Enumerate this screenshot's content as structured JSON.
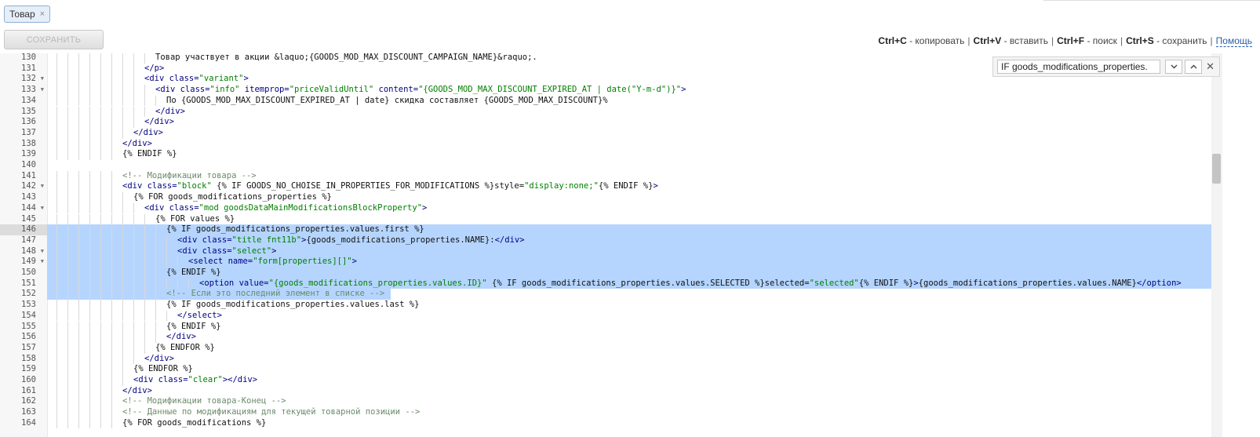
{
  "tab": {
    "label": "Товар",
    "close": "×"
  },
  "toolbar": {
    "save_label": "СОХРАНИТЬ"
  },
  "hints": {
    "copy_key": "Ctrl+C",
    "copy_text": " - копировать",
    "paste_key": "Ctrl+V",
    "paste_text": " - вставить",
    "find_key": "Ctrl+F",
    "find_text": " - поиск",
    "save_key": "Ctrl+S",
    "save_text": " - сохранить",
    "sep": "|",
    "help": "Помощь"
  },
  "search": {
    "value": "IF goods_modifications_properties."
  },
  "icons": {
    "down": "chevron-down-icon",
    "up": "chevron-up-icon",
    "close": "close-icon"
  },
  "colors": {
    "selection": "#b5d5ff",
    "tag": "#000080",
    "string": "#008000",
    "comment": "#6a8a6a"
  },
  "editor": {
    "active_line": 146,
    "lines": [
      {
        "n": "130",
        "fold": false,
        "indent": 9,
        "sel": false,
        "segs": [
          [
            "t",
            "Товар участвует в акции &laquo;{GOODS_MOD_MAX_DISCOUNT_CAMPAIGN_NAME}&raquo;."
          ]
        ]
      },
      {
        "n": "131",
        "fold": false,
        "indent": 8,
        "sel": false,
        "segs": [
          [
            "g",
            "</p>"
          ]
        ]
      },
      {
        "n": "132",
        "fold": true,
        "indent": 8,
        "sel": false,
        "segs": [
          [
            "g",
            "<div class="
          ],
          [
            "s",
            "\"variant\""
          ],
          [
            "g",
            ">"
          ]
        ]
      },
      {
        "n": "133",
        "fold": true,
        "indent": 9,
        "sel": false,
        "segs": [
          [
            "g",
            "<div class="
          ],
          [
            "s",
            "\"info\""
          ],
          [
            "g",
            " itemprop="
          ],
          [
            "s",
            "\"priceValidUntil\""
          ],
          [
            "g",
            " content="
          ],
          [
            "s",
            "\"{GOODS_MOD_MAX_DISCOUNT_EXPIRED_AT | date(\"Y-m-d\")}\""
          ],
          [
            "g",
            ">"
          ]
        ]
      },
      {
        "n": "134",
        "fold": false,
        "indent": 10,
        "sel": false,
        "segs": [
          [
            "t",
            "По {GOODS_MOD_MAX_DISCOUNT_EXPIRED_AT | date} скидка составляет {GOODS_MOD_MAX_DISCOUNT}%"
          ]
        ]
      },
      {
        "n": "135",
        "fold": false,
        "indent": 9,
        "sel": false,
        "segs": [
          [
            "g",
            "</div>"
          ]
        ]
      },
      {
        "n": "136",
        "fold": false,
        "indent": 8,
        "sel": false,
        "segs": [
          [
            "g",
            "</div>"
          ]
        ]
      },
      {
        "n": "137",
        "fold": false,
        "indent": 7,
        "sel": false,
        "segs": [
          [
            "g",
            "</div>"
          ]
        ]
      },
      {
        "n": "138",
        "fold": false,
        "indent": 6,
        "sel": false,
        "segs": [
          [
            "g",
            "</div>"
          ]
        ]
      },
      {
        "n": "139",
        "fold": false,
        "indent": 6,
        "sel": false,
        "segs": [
          [
            "t",
            "{% ENDIF %}"
          ]
        ]
      },
      {
        "n": "140",
        "fold": false,
        "indent": 0,
        "sel": false,
        "segs": []
      },
      {
        "n": "141",
        "fold": false,
        "indent": 6,
        "sel": false,
        "segs": [
          [
            "c",
            "<!-- Модификации товара -->"
          ]
        ]
      },
      {
        "n": "142",
        "fold": true,
        "indent": 6,
        "sel": false,
        "segs": [
          [
            "g",
            "<div class="
          ],
          [
            "s",
            "\"block\""
          ],
          [
            "t",
            " {% IF GOODS_NO_CHOISE_IN_PROPERTIES_FOR_MODIFICATIONS %}style="
          ],
          [
            "s",
            "\"display:none;\""
          ],
          [
            "t",
            "{% ENDIF %}"
          ],
          [
            "g",
            ">"
          ]
        ]
      },
      {
        "n": "143",
        "fold": false,
        "indent": 7,
        "sel": false,
        "segs": [
          [
            "t",
            "{% FOR goods_modifications_properties %}"
          ]
        ]
      },
      {
        "n": "144",
        "fold": true,
        "indent": 8,
        "sel": false,
        "segs": [
          [
            "g",
            "<div class="
          ],
          [
            "s",
            "\"mod goodsDataMainModificationsBlockProperty\""
          ],
          [
            "g",
            ">"
          ]
        ]
      },
      {
        "n": "145",
        "fold": false,
        "indent": 9,
        "sel": false,
        "segs": [
          [
            "t",
            "{% FOR values %}"
          ]
        ]
      },
      {
        "n": "146",
        "fold": false,
        "indent": 10,
        "sel": true,
        "segs": [
          [
            "t",
            "{% IF goods_modifications_properties.values.first %}"
          ]
        ]
      },
      {
        "n": "147",
        "fold": false,
        "indent": 11,
        "sel": true,
        "segs": [
          [
            "g",
            "<div class="
          ],
          [
            "s",
            "\"title fnt11b\""
          ],
          [
            "g",
            ">"
          ],
          [
            "t",
            "{goods_modifications_properties.NAME}:"
          ],
          [
            "g",
            "</div>"
          ]
        ]
      },
      {
        "n": "148",
        "fold": true,
        "indent": 11,
        "sel": true,
        "segs": [
          [
            "g",
            "<div class="
          ],
          [
            "s",
            "\"select\""
          ],
          [
            "g",
            ">"
          ]
        ]
      },
      {
        "n": "149",
        "fold": true,
        "indent": 12,
        "sel": true,
        "segs": [
          [
            "g",
            "<select name="
          ],
          [
            "s",
            "\"form[properties][]\""
          ],
          [
            "g",
            ">"
          ]
        ]
      },
      {
        "n": "150",
        "fold": false,
        "indent": 10,
        "sel": true,
        "segs": [
          [
            "t",
            "{% ENDIF %}"
          ]
        ]
      },
      {
        "n": "151",
        "fold": false,
        "indent": 13,
        "sel": true,
        "segs": [
          [
            "g",
            "<option value="
          ],
          [
            "s",
            "\"{goods_modifications_properties.values.ID}\""
          ],
          [
            "t",
            " {% IF goods_modifications_properties.values.SELECTED %}selected="
          ],
          [
            "s",
            "\"selected\""
          ],
          [
            "t",
            "{% ENDIF %}"
          ],
          [
            "g",
            ">"
          ],
          [
            "t",
            "{goods_modifications_properties.values.NAME}"
          ],
          [
            "g",
            "</option>"
          ]
        ]
      },
      {
        "n": "152",
        "fold": false,
        "indent": 10,
        "sel": true,
        "partial": true,
        "segs": [
          [
            "c",
            "<!-- Если это последний элемент в списке -->"
          ]
        ]
      },
      {
        "n": "153",
        "fold": false,
        "indent": 10,
        "sel": false,
        "segs": [
          [
            "t",
            "{% IF goods_modifications_properties.values.last %}"
          ]
        ]
      },
      {
        "n": "154",
        "fold": false,
        "indent": 11,
        "sel": false,
        "segs": [
          [
            "g",
            "</select>"
          ]
        ]
      },
      {
        "n": "155",
        "fold": false,
        "indent": 10,
        "sel": false,
        "segs": [
          [
            "t",
            "{% ENDIF %}"
          ]
        ]
      },
      {
        "n": "156",
        "fold": false,
        "indent": 10,
        "sel": false,
        "segs": [
          [
            "g",
            "</div>"
          ]
        ]
      },
      {
        "n": "157",
        "fold": false,
        "indent": 9,
        "sel": false,
        "segs": [
          [
            "t",
            "{% ENDFOR %}"
          ]
        ]
      },
      {
        "n": "158",
        "fold": false,
        "indent": 8,
        "sel": false,
        "segs": [
          [
            "g",
            "</div>"
          ]
        ]
      },
      {
        "n": "159",
        "fold": false,
        "indent": 7,
        "sel": false,
        "segs": [
          [
            "t",
            "{% ENDFOR %}"
          ]
        ]
      },
      {
        "n": "160",
        "fold": false,
        "indent": 7,
        "sel": false,
        "segs": [
          [
            "g",
            "<div class="
          ],
          [
            "s",
            "\"clear\""
          ],
          [
            "g",
            "></div>"
          ]
        ]
      },
      {
        "n": "161",
        "fold": false,
        "indent": 6,
        "sel": false,
        "segs": [
          [
            "g",
            "</div>"
          ]
        ]
      },
      {
        "n": "162",
        "fold": false,
        "indent": 6,
        "sel": false,
        "segs": [
          [
            "c",
            "<!-- Модификации товара-Конец -->"
          ]
        ]
      },
      {
        "n": "163",
        "fold": false,
        "indent": 6,
        "sel": false,
        "segs": [
          [
            "c",
            "<!-- Данные по модификациям для текущей товарной позиции -->"
          ]
        ]
      },
      {
        "n": "164",
        "fold": false,
        "indent": 6,
        "sel": false,
        "segs": [
          [
            "t",
            "{% FOR goods_modifications %}"
          ]
        ]
      }
    ]
  }
}
